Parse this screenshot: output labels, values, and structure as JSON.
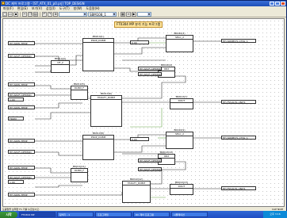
{
  "window": {
    "title": "DC 제어 프로그램 - [ST_ATX_01_p0.prj] TOP_DESIGN",
    "buttons": [
      "minimize",
      "maximize",
      "close"
    ]
  },
  "menu": [
    "파일(F)",
    "편집(E)",
    "보기(V)",
    "삽입(I)",
    "도구(T)",
    "창(W)",
    "도움말(H)"
  ],
  "toolbar": {
    "combo1": "",
    "combo2": "SBM108_1",
    "combo3": ""
  },
  "canvas": {
    "banner": "FT0304 MP 분석 기능 프로그램",
    "tags_in": [
      "HH-S0ML-TEMP",
      "HH-S0VF-OPTMOD",
      "HH-S0ML-TEMP",
      "HH-S0VF-OPTMOD",
      "HH-S0ML-TEMP",
      "FROM",
      "HH-S0ML-TEMP",
      "HH-S0VF-OPTMOD",
      "HH-S0ML-TEMP",
      "HH-S0VF-OPTMOD",
      "HH-S0ML-TEMP"
    ],
    "const_1": "1.00",
    "const_2": "1.00",
    "blocks": [
      {
        "id": "BK010(1)",
        "name": "PSDP_DCBM"
      },
      {
        "id": "BK040(2)",
        "name": "SELC_2"
      },
      {
        "id": "BK010(3)",
        "name": "OF_2"
      },
      {
        "id": "BK040(4)",
        "name": "OR2"
      },
      {
        "id": "BK010(5)",
        "name": "DLMD_F"
      },
      {
        "id": "BK010(6)",
        "name": "FASGTY_DCBM"
      },
      {
        "id": "BK010(7)",
        "name": "DOUT"
      },
      {
        "id": "BK010(8)",
        "name": "PSDP_DCBM"
      },
      {
        "id": "BK040(9)",
        "name": "SELC_2"
      },
      {
        "id": "BK010(10)",
        "name": "OR2"
      },
      {
        "id": "BK010(11)",
        "name": "DLMD_F"
      },
      {
        "id": "BK010(12)",
        "name": "FASGTY_DCBM"
      },
      {
        "id": "BK010(13)",
        "name": "DOUT"
      }
    ],
    "lit_1": "0.00",
    "lit_2": "0.00",
    "tags_mid": [
      "HH-S0VF-OPTMOD",
      "HH-S0VF-OPTMOD",
      "HH-S0VF-OPTMOD",
      "HH-S0VF-OPTMOD"
    ],
    "tags_out": [
      "HH-S0NMSTL-CTRL_1",
      "HH-FSS4LHL-UNIT1",
      "HH-S0NMSTL-CTRL_1",
      "HH-FSS4LHL-UNIT1"
    ]
  },
  "status": {
    "left": "도움말을 보려면 F1 키를 누르십시오.",
    "right": "CAP NUM"
  },
  "taskbar": {
    "start": "시작",
    "tasks": [
      "FT0304 MP",
      "탐색기 - 1",
      "프로그래밍",
      "DC 제어 프로그램",
      "시뮬레이션",
      "로그 뷰어"
    ],
    "clock": "오후 3:16"
  }
}
